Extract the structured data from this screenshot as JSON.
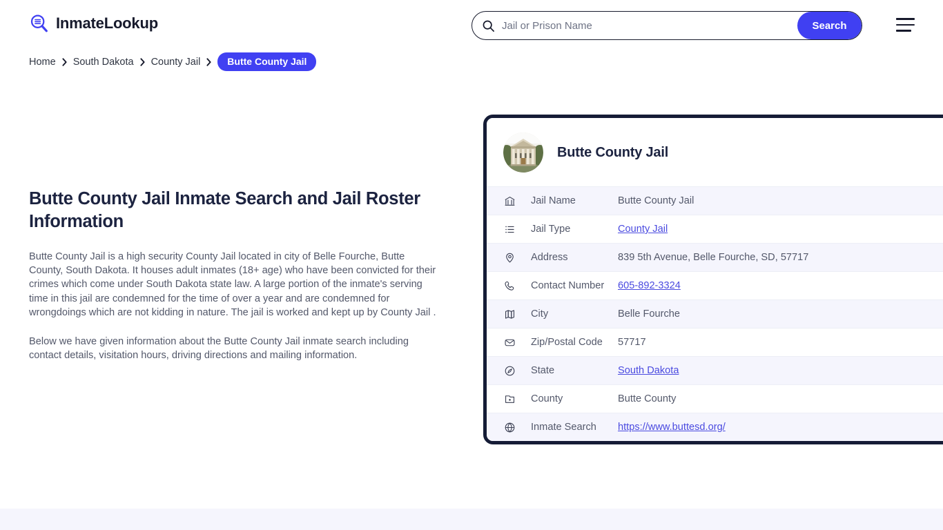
{
  "header": {
    "brand_name": "InmateLookup",
    "brand_icon": "magnifier-list-icon",
    "search": {
      "placeholder": "Jail or Prison Name",
      "value": "",
      "icon": "search-icon",
      "button_label": "Search"
    },
    "menu_icon": "hamburger-menu-icon"
  },
  "breadcrumb": {
    "items": [
      {
        "label": "Home",
        "current": false
      },
      {
        "label": "South Dakota",
        "current": false
      },
      {
        "label": "County Jail",
        "current": false
      },
      {
        "label": "Butte County Jail",
        "current": true
      }
    ]
  },
  "intro": {
    "title": "Butte County Jail Inmate Search and Jail Roster Information",
    "paragraph1": "Butte County Jail is a high security County Jail located in city of Belle Fourche, Butte County, South Dakota. It houses adult inmates (18+ age) who have been convicted for their crimes which come under South Dakota state law. A large portion of the inmate's serving time in this jail are condemned for the time of over a year and are condemned for wrongdoings which are not kidding in nature. The jail is worked and kept up by County Jail .",
    "paragraph2": "Below we have given information about the Butte County Jail inmate search including contact details, visitation hours, driving directions and mailing information."
  },
  "info_card": {
    "photo_alt": "courthouse-photo",
    "title": "Butte County Jail",
    "rows": [
      {
        "icon": "bank-icon",
        "label": "Jail Name",
        "value": "Butte County Jail",
        "link": false,
        "shaded": true
      },
      {
        "icon": "list-icon",
        "label": "Jail Type",
        "value": "County Jail",
        "link": true,
        "shaded": false
      },
      {
        "icon": "map-pin-icon",
        "label": "Address",
        "value": "839 5th Avenue, Belle Fourche, SD, 57717",
        "link": false,
        "shaded": true
      },
      {
        "icon": "phone-icon",
        "label": "Contact Number",
        "value": "605-892-3324",
        "link": true,
        "shaded": false
      },
      {
        "icon": "map-icon",
        "label": "City",
        "value": "Belle Fourche",
        "link": false,
        "shaded": true
      },
      {
        "icon": "envelope-icon",
        "label": "Zip/Postal Code",
        "value": "57717",
        "link": false,
        "shaded": false
      },
      {
        "icon": "compass-icon",
        "label": "State",
        "value": "South Dakota",
        "link": true,
        "shaded": true
      },
      {
        "icon": "map-region-icon",
        "label": "County",
        "value": "Butte County",
        "link": false,
        "shaded": false
      },
      {
        "icon": "globe-icon",
        "label": "Inmate Search",
        "value": "https://www.buttesd.org/",
        "link": true,
        "shaded": true
      }
    ]
  },
  "colors": {
    "accent_blue": "#4040f2",
    "link_blue": "#4a4ae0",
    "card_border_navy": "#151c36",
    "shaded_row": "#f5f5fd",
    "heading_navy": "#1c2340",
    "body_text": "#53586a"
  }
}
